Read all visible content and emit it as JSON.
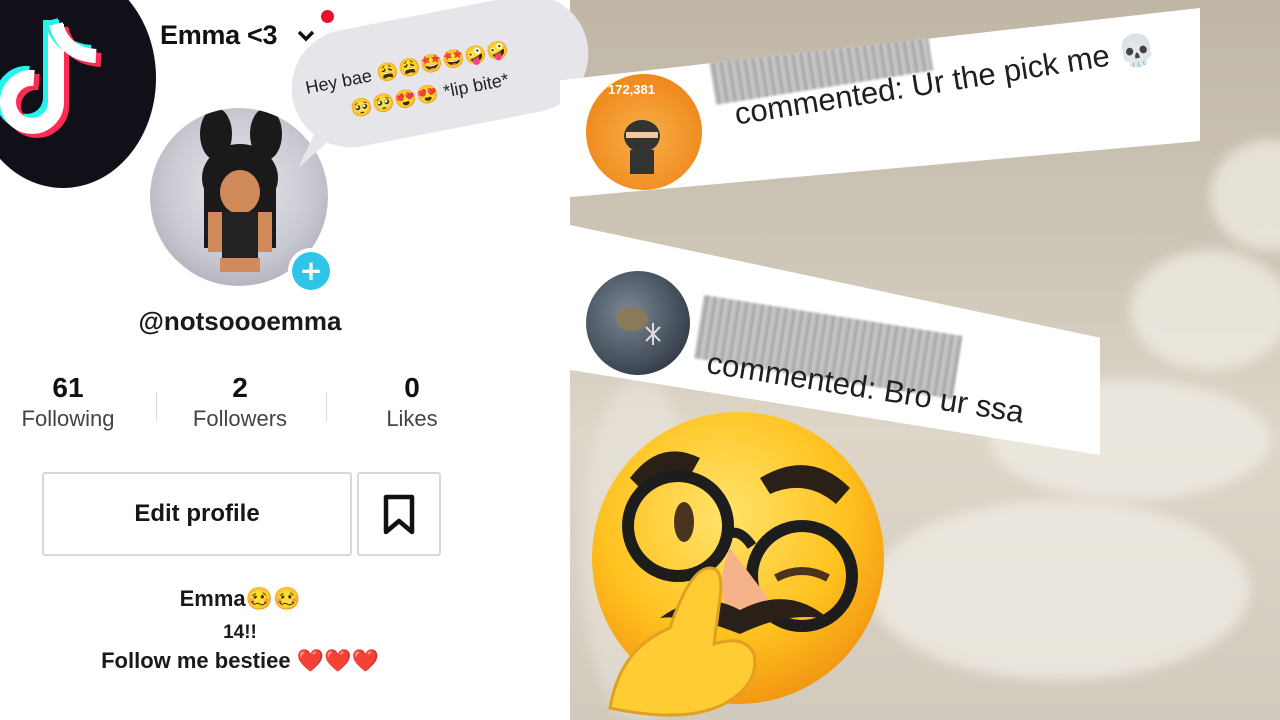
{
  "profile": {
    "display_name": "Emma <3",
    "handle": "@notsoooemma",
    "stats": [
      {
        "value": "61",
        "label": "Following"
      },
      {
        "value": "2",
        "label": "Followers"
      },
      {
        "value": "0",
        "label": "Likes"
      }
    ],
    "edit_button": "Edit profile",
    "bio": {
      "line1": "Emma🥴🥴",
      "line2": "14!!",
      "line3": "Follow me bestiee ❤️❤️❤️"
    }
  },
  "bubble": {
    "line1": "Hey bae 😩😩🤩🤩🤪🤪",
    "line2": "🥺🥺😍😍 *lip bite*"
  },
  "comments": [
    {
      "avatar_count": "172,381",
      "text": "commented: Ur the pick me 💀"
    },
    {
      "text": "commented: Bro ur ssa"
    }
  ],
  "colors": {
    "accent_cyan": "#2ec5e8",
    "accent_red": "#e8102b",
    "logo_bg": "#111018"
  },
  "icons": [
    "tiktok-logo-icon",
    "chevron-down-icon",
    "plus-icon",
    "bookmark-icon",
    "disguise-face-emoji"
  ]
}
